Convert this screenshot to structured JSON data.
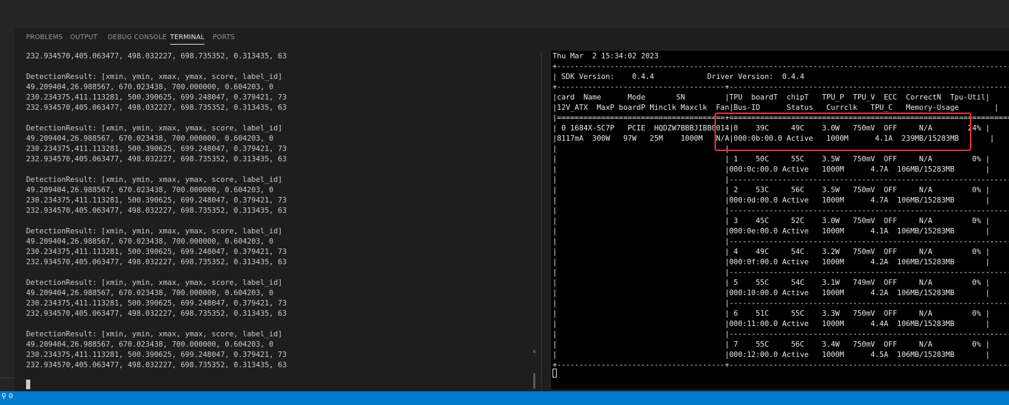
{
  "panel": {
    "tabs": [
      {
        "label": "PROBLEMS",
        "active": false
      },
      {
        "label": "OUTPUT",
        "active": false
      },
      {
        "label": "DEBUG CONSOLE",
        "active": false
      },
      {
        "label": "TERMINAL",
        "active": true
      },
      {
        "label": "PORTS",
        "active": false
      }
    ]
  },
  "left_terminal": {
    "lines": [
      "232.934570,405.063477, 498.032227, 698.735352, 0.313435, 63",
      "",
      "DetectionResult: [xmin, ymin, xmax, ymax, score, label_id]",
      "49.209404,26.988567, 670.023438, 700.000000, 0.604203, 0",
      "230.234375,411.113281, 500.390625, 699.248047, 0.379421, 73",
      "232.934570,405.063477, 498.032227, 698.735352, 0.313435, 63",
      "",
      "DetectionResult: [xmin, ymin, xmax, ymax, score, label_id]",
      "49.209404,26.988567, 670.023438, 700.000000, 0.604203, 0",
      "230.234375,411.113281, 500.390625, 699.248047, 0.379421, 73",
      "232.934570,405.063477, 498.032227, 698.735352, 0.313435, 63",
      "",
      "DetectionResult: [xmin, ymin, xmax, ymax, score, label_id]",
      "49.209404,26.988567, 670.023438, 700.000000, 0.604203, 0",
      "230.234375,411.113281, 500.390625, 699.248047, 0.379421, 73",
      "232.934570,405.063477, 498.032227, 698.735352, 0.313435, 63",
      "",
      "DetectionResult: [xmin, ymin, xmax, ymax, score, label_id]",
      "49.209404,26.988567, 670.023438, 700.000000, 0.604203, 0",
      "230.234375,411.113281, 500.390625, 699.248047, 0.379421, 73",
      "232.934570,405.063477, 498.032227, 698.735352, 0.313435, 63",
      "",
      "DetectionResult: [xmin, ymin, xmax, ymax, score, label_id]",
      "49.209404,26.988567, 670.023438, 700.000000, 0.604203, 0",
      "230.234375,411.113281, 500.390625, 699.248047, 0.379421, 73",
      "232.934570,405.063477, 498.032227, 698.735352, 0.313435, 63",
      "",
      "DetectionResult: [xmin, ymin, xmax, ymax, score, label_id]",
      "49.209404,26.988567, 670.023438, 700.000000, 0.604203, 0",
      "230.234375,411.113281, 500.390625, 699.248047, 0.379421, 73",
      "232.934570,405.063477, 498.032227, 698.735352, 0.313435, 63"
    ]
  },
  "right_terminal": {
    "lines": [
      "Thu Mar  2 15:34:02 2023",
      "+--------------------------------------------------------------------------------------------------------+",
      "| SDK Version:    0.4.4            Driver Version:  0.4.4                                                |",
      "+--------------------------------------+-----------------------------------------------------------------+",
      "|card  Name      Mode       SN         |TPU  boardT  chipT   TPU_P  TPU_V  ECC  CorrectN  Tpu-Util|",
      "|12V_ATX  MaxP boardP Minclk Maxclk  Fan|Bus-ID      Status   Currclk   TPU_C   Memory-Usage        |",
      "|======================================+=================================================================|",
      "| 0 1684X-SC7P   PCIE  HQDZW7BBBJIBB0014|0    39C     49C    3.0W   750mV  OFF     N/A        24% |",
      "|8117mA  300W   97W   25M    1000M   N/A|000:0b:00.0 Active   1000M      4.1A  239MB/15283MB       |",
      "|                                      |                                                                 |",
      "|                                      | 1    50C     55C    3.5W   750mV  OFF     N/A         0% |",
      "|                                      |000:0c:00.0 Active   1000M      4.7A  106MB/15283MB       |",
      "|                                      |-----------------------------------------------------------------|",
      "|                                      | 2    53C     56C    3.5W   750mV  OFF     N/A         0% |",
      "|                                      |000:0d:00.0 Active   1000M      4.7A  106MB/15283MB       |",
      "|                                      |-----------------------------------------------------------------|",
      "|                                      | 3    45C     52C    3.0W   750mV  OFF     N/A         0% |",
      "|                                      |000:0e:00.0 Active   1000M      4.1A  106MB/15283MB       |",
      "|                                      |-----------------------------------------------------------------|",
      "|                                      | 4    49C     54C    3.2W   750mV  OFF     N/A         0% |",
      "|                                      |000:0f:00.0 Active   1000M      4.2A  106MB/15283MB       |",
      "|                                      |-----------------------------------------------------------------|",
      "|                                      | 5    55C     54C    3.1W   749mV  OFF     N/A         0% |",
      "|                                      |000:10:00.0 Active   1000M      4.2A  106MB/15283MB       |",
      "|                                      |-----------------------------------------------------------------|",
      "|                                      | 6    51C     55C    3.3W   750mV  OFF     N/A         0% |",
      "|                                      |000:11:00.0 Active   1000M      4.4A  106MB/15283MB       |",
      "|                                      |-----------------------------------------------------------------|",
      "|                                      | 7    55C     56C    3.4W   750mV  OFF     N/A         0% |",
      "|                                      |000:12:00.0 Active   1000M      4.5A  106MB/15283MB       |",
      "+--------------------------------------+-----------------------------------------------------------------+"
    ]
  },
  "status_bar": {
    "notification": "0"
  },
  "colors": {
    "accent": "#007acc",
    "highlight": "#e8363a"
  }
}
